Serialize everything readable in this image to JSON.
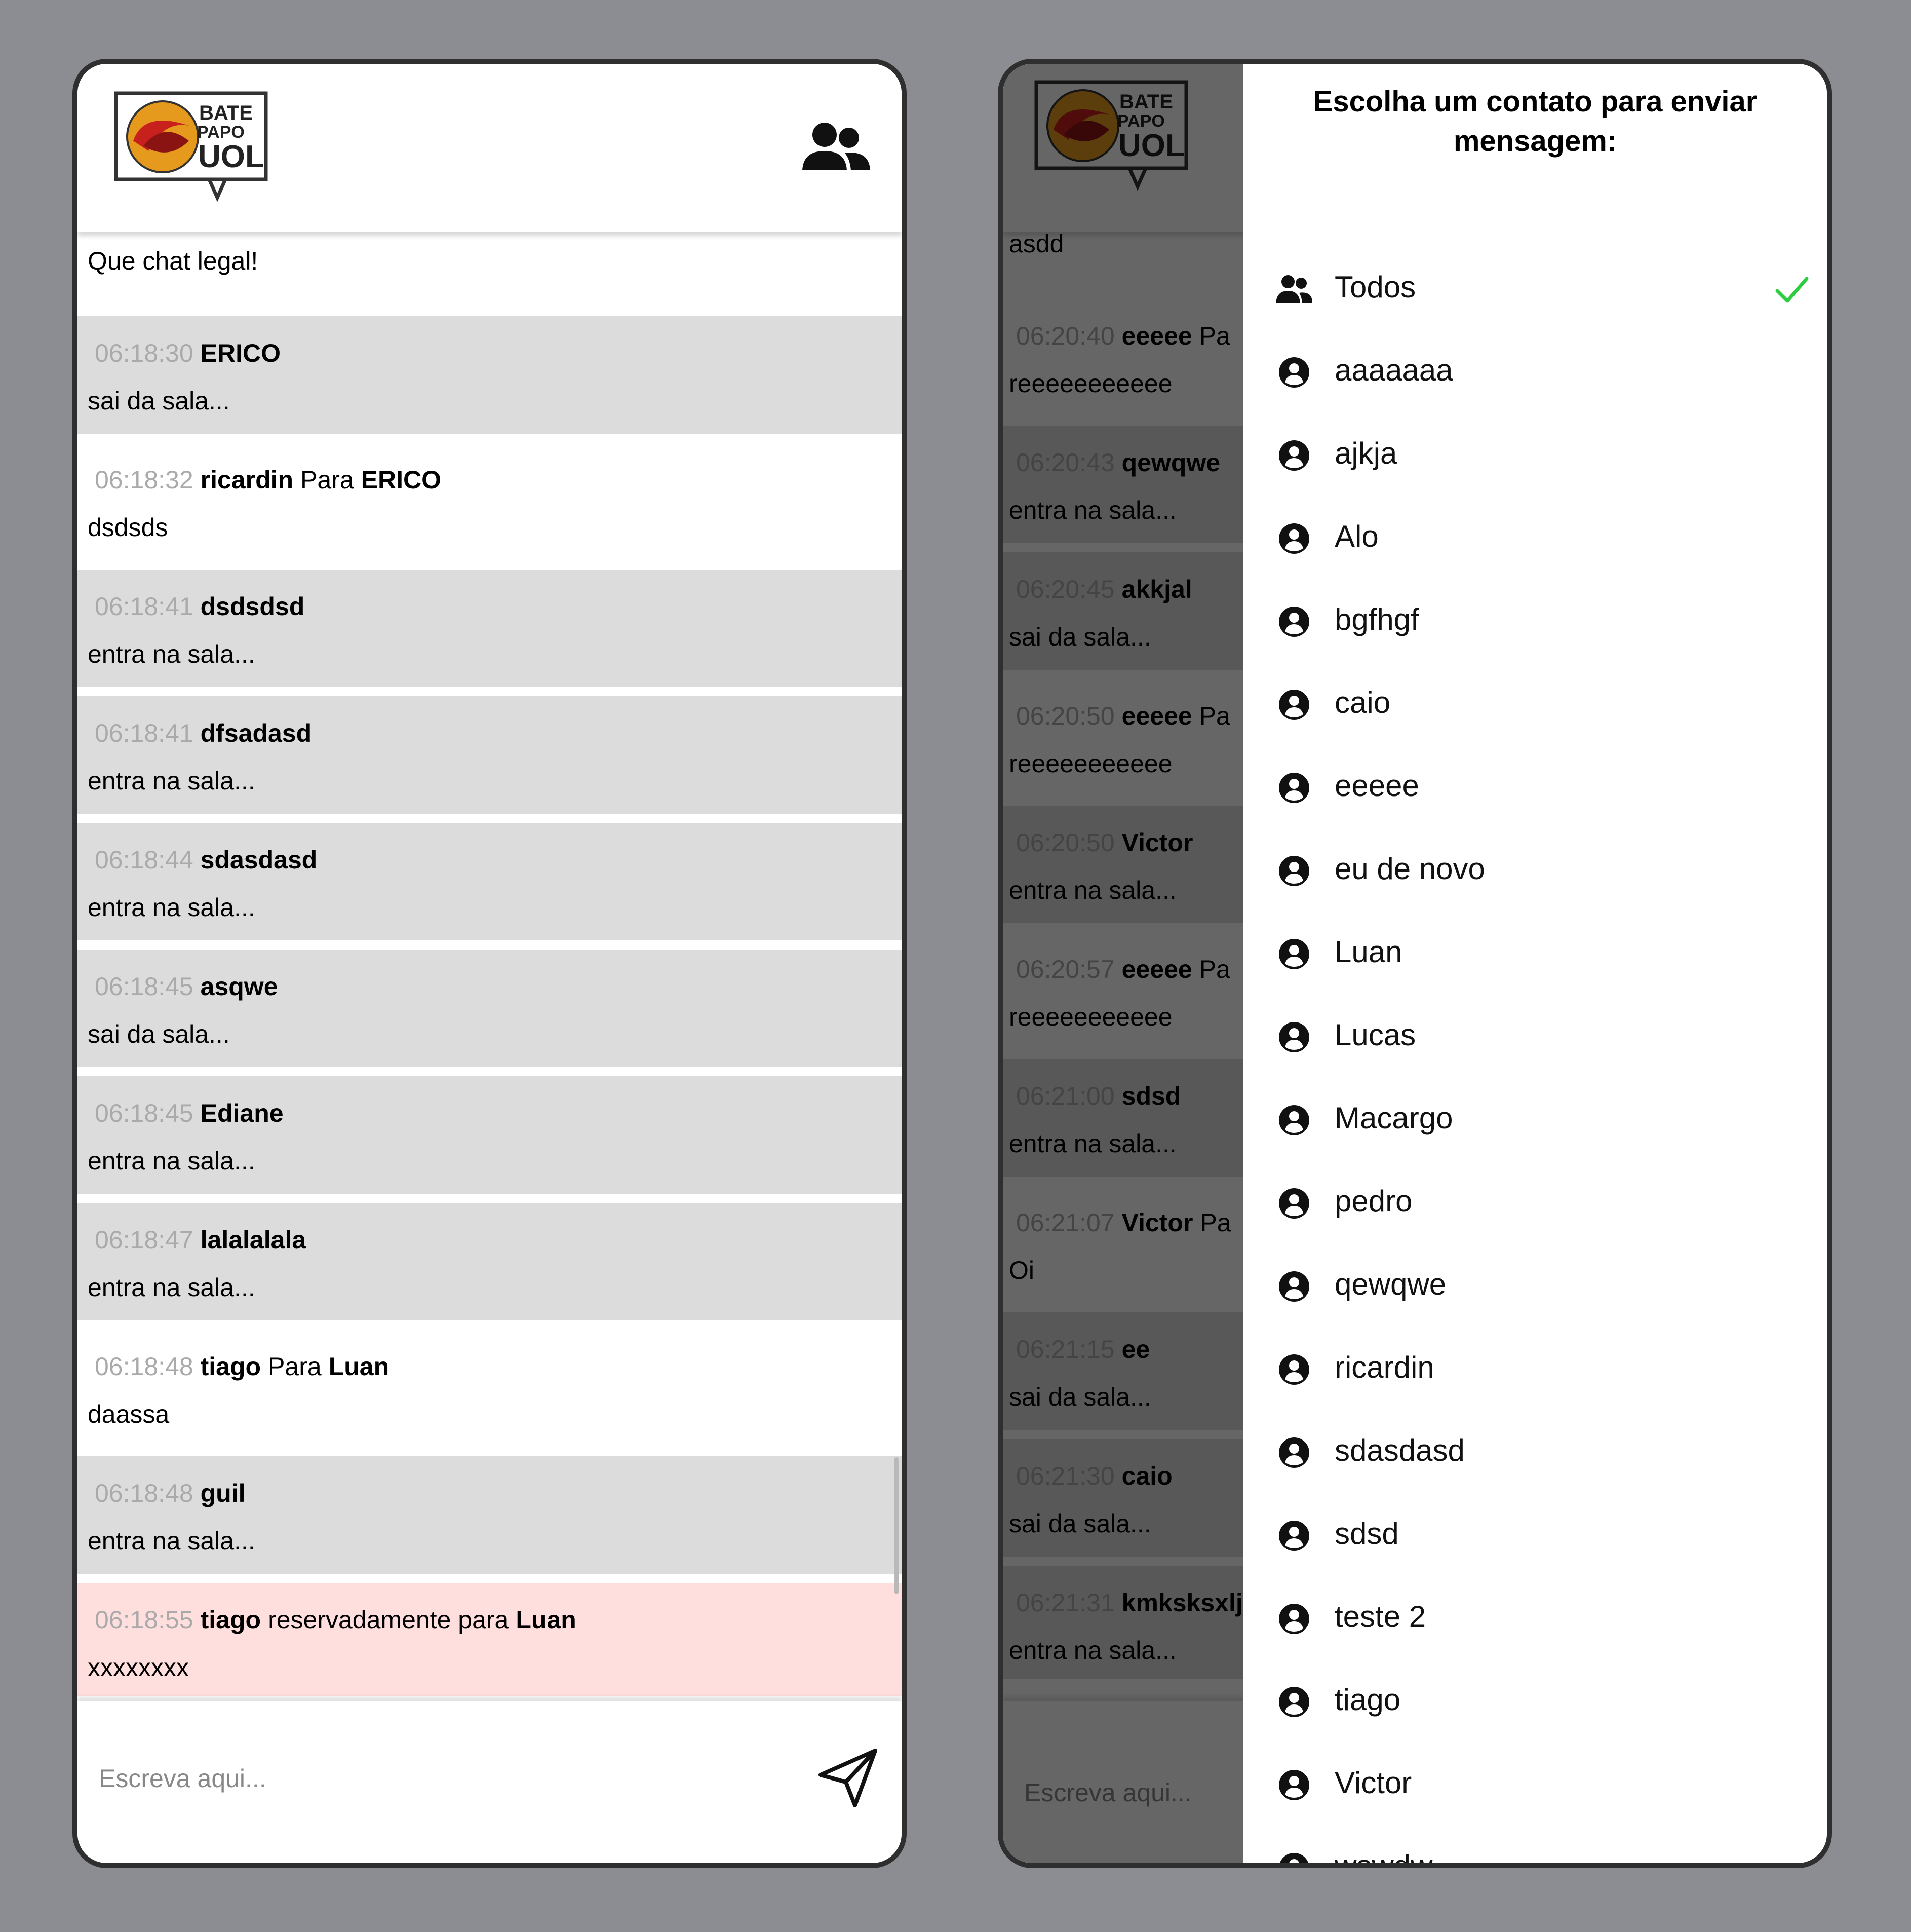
{
  "left": {
    "logo": {
      "line1": "BATE",
      "line2": "PAPO",
      "line3": "UOL"
    },
    "messages": [
      {
        "kind": "plain",
        "time": "",
        "from": "",
        "keyword": "",
        "to": "",
        "text": "Que chat legal!"
      },
      {
        "kind": "status",
        "time": "06:18:30",
        "from": "ERICO",
        "keyword": "",
        "to": "",
        "text": "sai da sala..."
      },
      {
        "kind": "plain",
        "time": "06:18:32",
        "from": "ricardin",
        "keyword": "Para",
        "to": "ERICO",
        "text": "dsdsds"
      },
      {
        "kind": "status",
        "time": "06:18:41",
        "from": "dsdsdsd",
        "keyword": "",
        "to": "",
        "text": "entra na sala..."
      },
      {
        "kind": "status",
        "time": "06:18:41",
        "from": "dfsadasd",
        "keyword": "",
        "to": "",
        "text": "entra na sala..."
      },
      {
        "kind": "status",
        "time": "06:18:44",
        "from": "sdasdasd",
        "keyword": "",
        "to": "",
        "text": "entra na sala..."
      },
      {
        "kind": "status",
        "time": "06:18:45",
        "from": "asqwe",
        "keyword": "",
        "to": "",
        "text": "sai da sala..."
      },
      {
        "kind": "status",
        "time": "06:18:45",
        "from": "Ediane",
        "keyword": "",
        "to": "",
        "text": "entra na sala..."
      },
      {
        "kind": "status",
        "time": "06:18:47",
        "from": "lalalalala",
        "keyword": "",
        "to": "",
        "text": "entra na sala..."
      },
      {
        "kind": "plain",
        "time": "06:18:48",
        "from": "tiago",
        "keyword": "Para",
        "to": "Luan",
        "text": "daassa"
      },
      {
        "kind": "status",
        "time": "06:18:48",
        "from": "guil",
        "keyword": "",
        "to": "",
        "text": "entra na sala..."
      },
      {
        "kind": "private",
        "time": "06:18:55",
        "from": "tiago",
        "keyword": "reservadamente para",
        "to": "Luan",
        "text": "xxxxxxxx"
      }
    ],
    "input_placeholder": "Escreva aqui..."
  },
  "right": {
    "messages": [
      {
        "kind": "plain",
        "time": "",
        "from": "",
        "keyword": "",
        "to": "",
        "text": "asdd"
      },
      {
        "kind": "plain",
        "time": "06:20:40",
        "from": "eeeee",
        "keyword": "Pa",
        "to": "",
        "text": "reeeeeeeeeee"
      },
      {
        "kind": "status",
        "time": "06:20:43",
        "from": "qewqwe",
        "keyword": "",
        "to": "",
        "text": "entra na sala..."
      },
      {
        "kind": "status",
        "time": "06:20:45",
        "from": "akkjal",
        "keyword": "",
        "to": "",
        "text": "sai da sala..."
      },
      {
        "kind": "plain",
        "time": "06:20:50",
        "from": "eeeee",
        "keyword": "Pa",
        "to": "",
        "text": "reeeeeeeeeee"
      },
      {
        "kind": "status",
        "time": "06:20:50",
        "from": "Victor",
        "keyword": "",
        "to": "",
        "text": "entra na sala..."
      },
      {
        "kind": "plain",
        "time": "06:20:57",
        "from": "eeeee",
        "keyword": "Pa",
        "to": "",
        "text": "reeeeeeeeeee"
      },
      {
        "kind": "status",
        "time": "06:21:00",
        "from": "sdsd",
        "keyword": "",
        "to": "",
        "text": "entra na sala..."
      },
      {
        "kind": "plain",
        "time": "06:21:07",
        "from": "Victor",
        "keyword": "Pa",
        "to": "",
        "text": "Oi"
      },
      {
        "kind": "status",
        "time": "06:21:15",
        "from": "ee",
        "keyword": "",
        "to": "",
        "text": "sai da sala..."
      },
      {
        "kind": "status",
        "time": "06:21:30",
        "from": "caio",
        "keyword": "",
        "to": "",
        "text": "sai da sala..."
      },
      {
        "kind": "status",
        "time": "06:21:31",
        "from": "kmksksxlj",
        "keyword": "",
        "to": "",
        "text": "entra na sala..."
      }
    ],
    "input_placeholder": "Escreva aqui...",
    "sidebar": {
      "title": "Escolha um contato para enviar mensagem:",
      "contacts": [
        {
          "name": "Todos",
          "icon": "people-icon",
          "selected": true
        },
        {
          "name": "aaaaaaa",
          "icon": "user-circle-icon",
          "selected": false
        },
        {
          "name": "ajkja",
          "icon": "user-circle-icon",
          "selected": false
        },
        {
          "name": "Alo",
          "icon": "user-circle-icon",
          "selected": false
        },
        {
          "name": "bgfhgf",
          "icon": "user-circle-icon",
          "selected": false
        },
        {
          "name": "caio",
          "icon": "user-circle-icon",
          "selected": false
        },
        {
          "name": "eeeee",
          "icon": "user-circle-icon",
          "selected": false
        },
        {
          "name": "eu de novo",
          "icon": "user-circle-icon",
          "selected": false
        },
        {
          "name": "Luan",
          "icon": "user-circle-icon",
          "selected": false
        },
        {
          "name": "Lucas",
          "icon": "user-circle-icon",
          "selected": false
        },
        {
          "name": "Macargo",
          "icon": "user-circle-icon",
          "selected": false
        },
        {
          "name": "pedro",
          "icon": "user-circle-icon",
          "selected": false
        },
        {
          "name": "qewqwe",
          "icon": "user-circle-icon",
          "selected": false
        },
        {
          "name": "ricardin",
          "icon": "user-circle-icon",
          "selected": false
        },
        {
          "name": "sdasdasd",
          "icon": "user-circle-icon",
          "selected": false
        },
        {
          "name": "sdsd",
          "icon": "user-circle-icon",
          "selected": false
        },
        {
          "name": "teste 2",
          "icon": "user-circle-icon",
          "selected": false
        },
        {
          "name": "tiago",
          "icon": "user-circle-icon",
          "selected": false
        },
        {
          "name": "Victor",
          "icon": "user-circle-icon",
          "selected": false
        },
        {
          "name": "wswdw",
          "icon": "user-circle-icon",
          "selected": false
        }
      ]
    }
  },
  "colors": {
    "page_background": "#8c8d92",
    "status_message": "#dcdcdc",
    "private_message": "#ffdede",
    "timestamp": "#aaaaaa",
    "check": "#2ecc40"
  }
}
